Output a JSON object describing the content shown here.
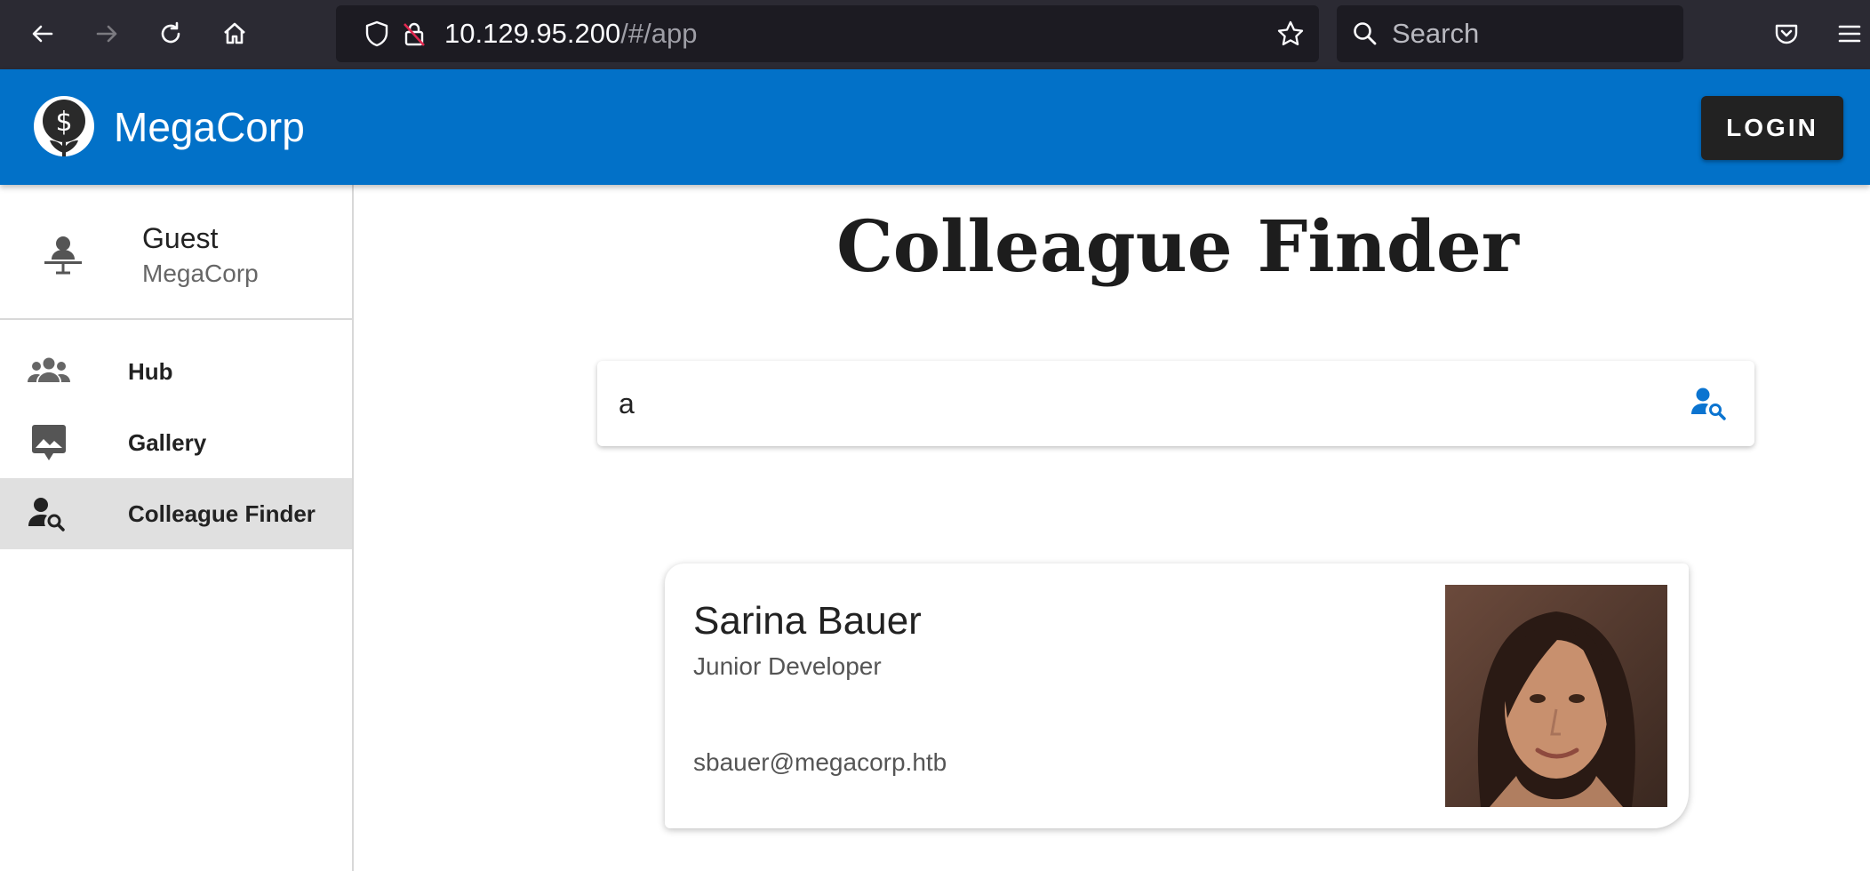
{
  "browser": {
    "url_host": "10.129.95.200",
    "url_path": "/#/app",
    "search_placeholder": "Search"
  },
  "header": {
    "brand": "MegaCorp",
    "login_label": "LOGIN"
  },
  "sidebar": {
    "user_name": "Guest",
    "user_org": "MegaCorp",
    "items": [
      {
        "label": "Hub",
        "icon": "group-icon"
      },
      {
        "label": "Gallery",
        "icon": "image-icon"
      },
      {
        "label": "Colleague Finder",
        "icon": "person-search-icon",
        "active": true
      }
    ]
  },
  "main": {
    "title": "Colleague Finder",
    "search_value": "a"
  },
  "results": [
    {
      "name": "Sarina Bauer",
      "role": "Junior Developer",
      "email": "sbauer@megacorp.htb"
    }
  ],
  "colors": {
    "header_bg": "#0271c8",
    "login_bg": "#222222",
    "active_item_bg": "#e0e0e0",
    "accent": "#0b74d0"
  }
}
